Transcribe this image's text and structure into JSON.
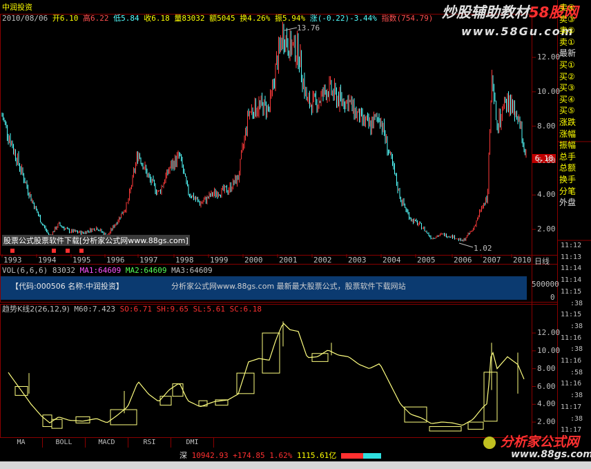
{
  "stock_name": "中润投资",
  "quote": {
    "date": "2010/08/06",
    "open": "开6.10",
    "high": "高6.22",
    "low": "低5.84",
    "close": "收6.18",
    "volume": "量83032",
    "amount": "额5045",
    "turnover": "换4.26%",
    "amplitude": "振5.94%",
    "change": "涨(-0.22)-3.44%",
    "index_label": "指数",
    "index_value": "(754.79)"
  },
  "watermark": {
    "brand": "炒股辅助教材",
    "brand_site": "58股网",
    "url": "www.58Gu.com",
    "bottom_brand": "分析家公式网",
    "bottom_url": "www.88gs.com"
  },
  "price_chart": {
    "peak_label": "13.76",
    "trough_label": "1.02",
    "current_price_tag": "6.18",
    "y_ticks": [
      "12.00",
      "10.00",
      "8.00",
      "6.00",
      "4.00",
      "2.00"
    ],
    "years": [
      "1993",
      "1994",
      "1995",
      "1996",
      "1997",
      "1998",
      "1999",
      "2000",
      "2001",
      "2002",
      "2003",
      "2004",
      "2005",
      "2006",
      "2007",
      "2010"
    ],
    "period": "日线",
    "overlay_note": "股票公式股票软件下载[分析家公式网www.88gs.com]",
    "colors": {
      "up": "#ff3a3a",
      "down": "#54ffff",
      "background": "#000000",
      "grid": "#8b0000"
    }
  },
  "vol_panel": {
    "label": "VOL(6,6,6)",
    "value": "83032",
    "ma1": "MA1:64609",
    "ma2": "MA2:64609",
    "ma3": "MA3:64609",
    "banner": "【代码:000506 名称:中润投资】",
    "banner2": "分析家公式网www.88gs.com 最新最大股票公式，股票软件下载网站",
    "y_ticks": [
      "500000",
      "0"
    ]
  },
  "indicator_panel": {
    "name": "趋势K线2(26,12,9)",
    "m60": "M60:7.423",
    "values": "SO:6.71 SH:9.65 SL:5.61 SC:6.18",
    "y_ticks": [
      "12.00",
      "10.00",
      "8.00",
      "6.00",
      "4.00",
      "2.00"
    ]
  },
  "order_book": {
    "labels": [
      "卖④",
      "卖③",
      "卖②",
      "卖①",
      "最新",
      "买①",
      "买②",
      "买③",
      "买④",
      "买⑤",
      "涨跌",
      "涨幅",
      "振幅",
      "总手",
      "总额",
      "换手",
      "分笔",
      "外盘"
    ],
    "times": [
      "11:12",
      "11:13",
      "11:14",
      "11:14",
      "11:15",
      ":38",
      "11:15",
      ":38",
      "11:16",
      ":38",
      "11:16",
      ":58",
      "11:16",
      ":38",
      "11:17",
      ":38",
      "11:17"
    ]
  },
  "tabs": [
    "MA",
    "BOLL",
    "MACD",
    "RSI",
    "DMI"
  ],
  "status_bar": {
    "market": "深",
    "index": "10942.93",
    "change": "+174.85",
    "percent": "1.62%",
    "amount": "1115.61亿"
  }
}
